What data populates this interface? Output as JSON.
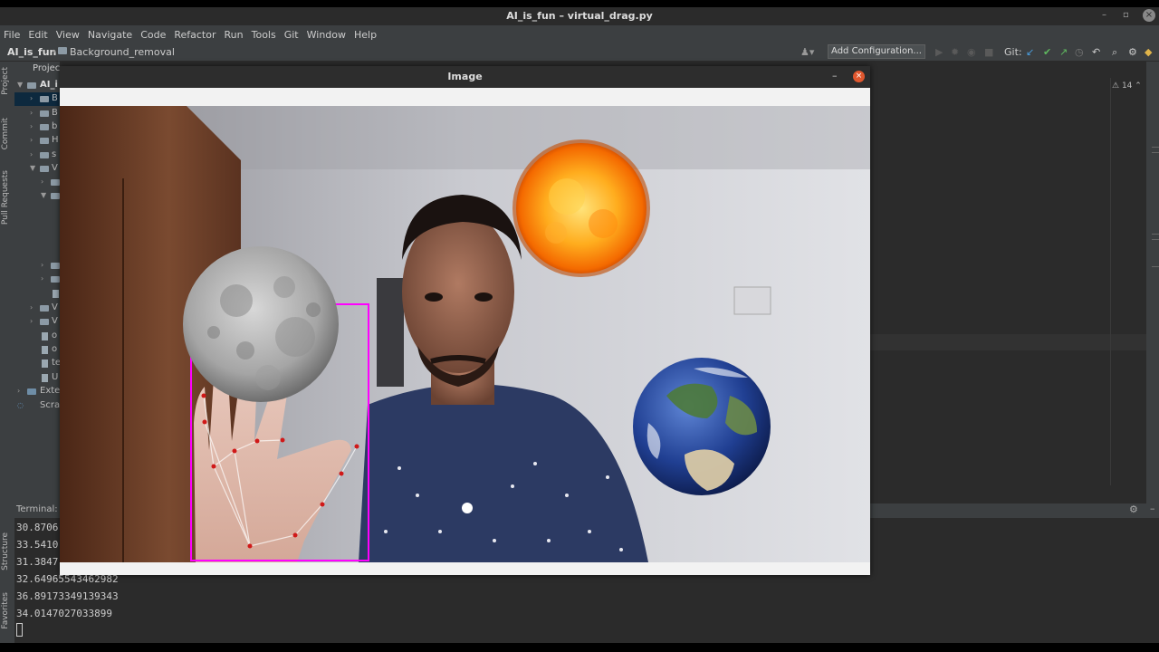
{
  "window": {
    "title": "AI_is_fun – virtual_drag.py"
  },
  "menu": [
    "File",
    "Edit",
    "View",
    "Navigate",
    "Code",
    "Refactor",
    "Run",
    "Tools",
    "Git",
    "Window",
    "Help"
  ],
  "breadcrumb": {
    "project": "AI_is_fun",
    "folder": "Background_removal"
  },
  "toolbar": {
    "add_configuration": "Add Configuration...",
    "git_label": "Git:"
  },
  "side_tabs": {
    "project": "Project",
    "commit": "Commit",
    "pull_requests": "Pull Requests",
    "structure": "Structure",
    "favorites": "Favorites"
  },
  "project_panel": {
    "header": "Project",
    "root": "AI_i",
    "rows": [
      "B",
      "B",
      "b",
      "H",
      "s",
      "V",
      "",
      "",
      "",
      "",
      "V",
      "V",
      "o",
      "o",
      "te",
      "U",
      "Exte",
      "Scra"
    ]
  },
  "editor": {
    "warnings": "14"
  },
  "terminal": {
    "label": "Terminal:",
    "lines": [
      "30.8706",
      "33.5410",
      "31.3847",
      "32.64965543462982",
      "36.89173349139343",
      "34.0147027033899"
    ]
  },
  "image_window": {
    "title": "Image",
    "objects": [
      "moon",
      "sun",
      "earth"
    ]
  },
  "colors": {
    "ide_bg": "#2b2b2b",
    "panel_bg": "#3c3f41",
    "bbox": "#ff00ff",
    "landmark": "#cc1111",
    "close_button": "#e0572e"
  }
}
